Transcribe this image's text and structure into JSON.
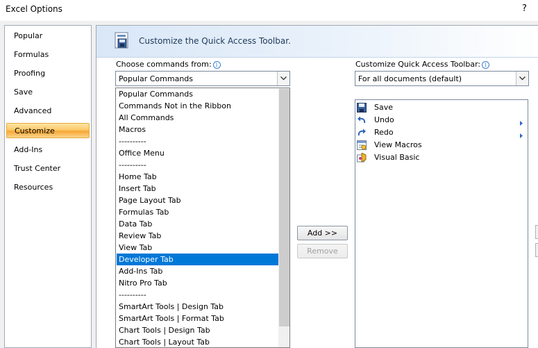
{
  "window": {
    "title": "Excel Options",
    "help": "?"
  },
  "nav": {
    "items": [
      {
        "label": "Popular",
        "active": false
      },
      {
        "label": "Formulas",
        "active": false
      },
      {
        "label": "Proofing",
        "active": false
      },
      {
        "label": "Save",
        "active": false
      },
      {
        "label": "Advanced",
        "active": false
      },
      {
        "label": "Customize",
        "active": true
      },
      {
        "label": "Add-Ins",
        "active": false
      },
      {
        "label": "Trust Center",
        "active": false
      },
      {
        "label": "Resources",
        "active": false
      }
    ]
  },
  "header": {
    "title": "Customize the Quick Access Toolbar.",
    "icon": "customize-qat-icon"
  },
  "choose": {
    "label": "Choose commands from:",
    "value": "Popular Commands",
    "options": [
      "Popular Commands",
      "Commands Not in the Ribbon",
      "All Commands",
      "Macros",
      "----------",
      "Office Menu",
      "----------",
      "Home Tab",
      "Insert Tab",
      "Page Layout Tab",
      "Formulas Tab",
      "Data Tab",
      "Review Tab",
      "View Tab",
      "Developer Tab",
      "Add-Ins Tab",
      "Nitro Pro Tab",
      "----------",
      "SmartArt Tools | Design Tab",
      "SmartArt Tools | Format Tab",
      "Chart Tools | Design Tab",
      "Chart Tools | Layout Tab"
    ],
    "selected": "Developer Tab"
  },
  "qat": {
    "label": "Customize Quick Access Toolbar:",
    "value": "For all documents (default)",
    "items": [
      {
        "label": "Save",
        "icon": "save-icon",
        "submenu": false
      },
      {
        "label": "Undo",
        "icon": "undo-icon",
        "submenu": true
      },
      {
        "label": "Redo",
        "icon": "redo-icon",
        "submenu": true
      },
      {
        "label": "View Macros",
        "icon": "view-macros-icon",
        "submenu": false
      },
      {
        "label": "Visual Basic",
        "icon": "visual-basic-icon",
        "submenu": false
      }
    ]
  },
  "buttons": {
    "add": "Add >>",
    "remove": "Remove"
  },
  "colors": {
    "selection": "#0078d7",
    "active_nav": "#fbc96a",
    "header": "#d9e7f7"
  }
}
